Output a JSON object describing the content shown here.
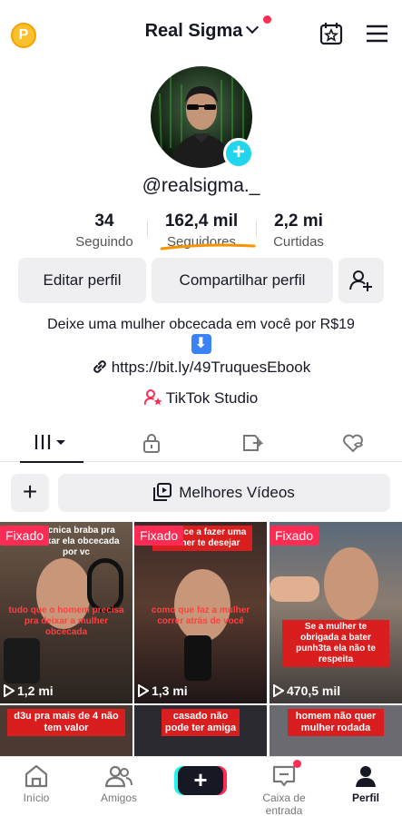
{
  "header": {
    "coin_label": "P",
    "title": "Real Sigma"
  },
  "profile": {
    "username": "@realsigma._"
  },
  "stats": [
    {
      "value": "34",
      "label": "Seguindo"
    },
    {
      "value": "162,4 mil",
      "label": "Seguidores"
    },
    {
      "value": "2,2 mi",
      "label": "Curtidas"
    }
  ],
  "actions": {
    "edit_label": "Editar perfil",
    "share_label": "Compartilhar perfil"
  },
  "bio": {
    "text": "Deixe uma mulher obcecada em você por R$19",
    "link": "https://bit.ly/49TruquesEbook",
    "studio": "TikTok Studio"
  },
  "best_videos_label": "Melhores Vídeos",
  "videos": [
    {
      "pinned": "Fixado",
      "caption_top": "Técnica braba pra deixar ela obcecada por vc",
      "caption_mid": "tudo que o homem precisa pra deixar a mulher obcecada",
      "views": "1,2 mi"
    },
    {
      "pinned": "Fixado",
      "caption_top": "Comece a fazer uma mulher te desejar",
      "caption_mid": "como que faz a mulher correr atrás de você",
      "views": "1,3 mi"
    },
    {
      "pinned": "Fixado",
      "caption_top": "",
      "caption_mid": "Se a mulher te obrigada a bater punh3ta ela não te respeita",
      "views": "470,5 mil"
    },
    {
      "caption_top": "d3u pra mais de 4 não tem valor"
    },
    {
      "caption_top": "casado não pode ter amiga"
    },
    {
      "caption_top": "homem não quer mulher rodada"
    }
  ],
  "nav": [
    {
      "label": "Início"
    },
    {
      "label": "Amigos"
    },
    {
      "label": "Caixa de entrada"
    },
    {
      "label": "Perfil"
    }
  ]
}
